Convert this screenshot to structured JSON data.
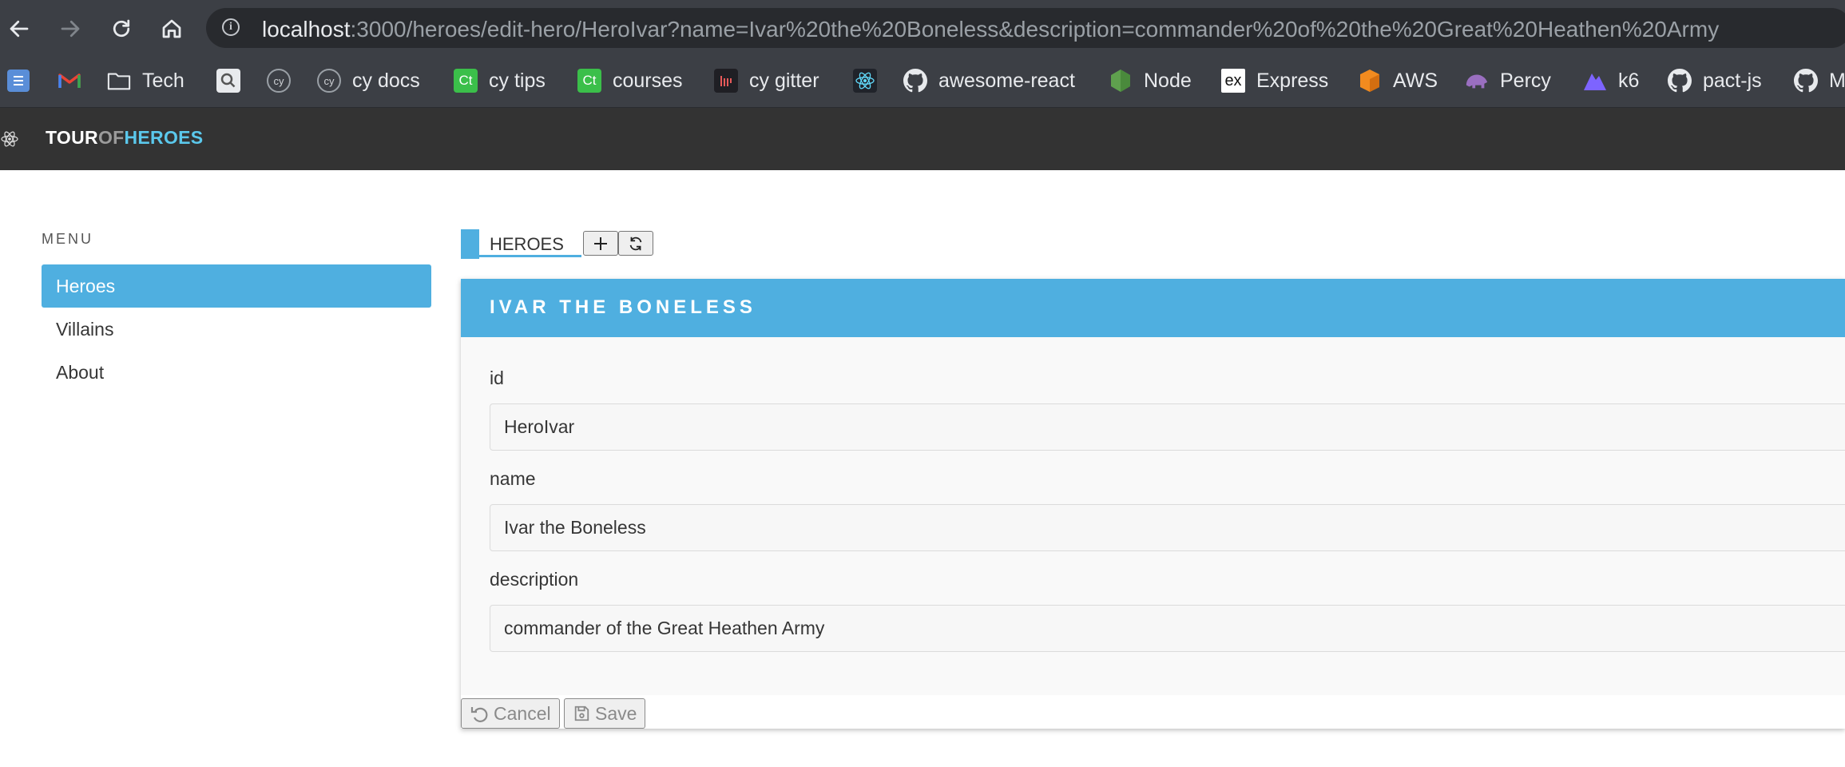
{
  "browser": {
    "url_host": "localhost",
    "url_path": ":3000/heroes/edit-hero/HeroIvar?name=Ivar%20the%20Boneless&description=commander%20of%20the%20Great%20Heathen%20Army",
    "bookmarks": [
      {
        "label": "",
        "icon": "bookmark-app-icon"
      },
      {
        "label": "",
        "icon": "gmail-icon"
      },
      {
        "label": "Tech",
        "icon": "folder-icon"
      },
      {
        "label": "",
        "icon": "search-bookmark-icon"
      },
      {
        "label": "",
        "icon": "cypress-icon"
      },
      {
        "label": "cy docs",
        "icon": "cypress-icon"
      },
      {
        "label": "cy tips",
        "icon": "cypress-ct-icon"
      },
      {
        "label": "courses",
        "icon": "cypress-ct-icon"
      },
      {
        "label": "cy gitter",
        "icon": "gitter-icon"
      },
      {
        "label": "",
        "icon": "react-icon"
      },
      {
        "label": "awesome-react",
        "icon": "github-icon"
      },
      {
        "label": "Node",
        "icon": "node-icon"
      },
      {
        "label": "Express",
        "icon": "express-icon"
      },
      {
        "label": "AWS",
        "icon": "aws-icon"
      },
      {
        "label": "Percy",
        "icon": "percy-icon"
      },
      {
        "label": "k6",
        "icon": "k6-icon"
      },
      {
        "label": "pact-js",
        "icon": "github-icon"
      },
      {
        "label": "M",
        "icon": "github-icon"
      }
    ]
  },
  "header": {
    "brand_tour": "TOUR",
    "brand_of": "OF",
    "brand_heroes": "HEROES"
  },
  "sidebar": {
    "menu_label": "MENU",
    "items": [
      {
        "label": "Heroes",
        "active": true
      },
      {
        "label": "Villains",
        "active": false
      },
      {
        "label": "About",
        "active": false
      }
    ]
  },
  "list": {
    "title": "HEROES",
    "add_icon": "plus-icon",
    "refresh_icon": "refresh-icon"
  },
  "detail": {
    "title": "Ivar the Boneless",
    "fields": [
      {
        "label": "id",
        "value": "HeroIvar"
      },
      {
        "label": "name",
        "value": "Ivar the Boneless"
      },
      {
        "label": "description",
        "value": "commander of the Great Heathen Army"
      }
    ],
    "cancel_label": "Cancel",
    "save_label": "Save"
  },
  "colors": {
    "accent": "#4fafe0",
    "header_bg": "#333333",
    "brand_heroes": "#5bc8ec"
  }
}
